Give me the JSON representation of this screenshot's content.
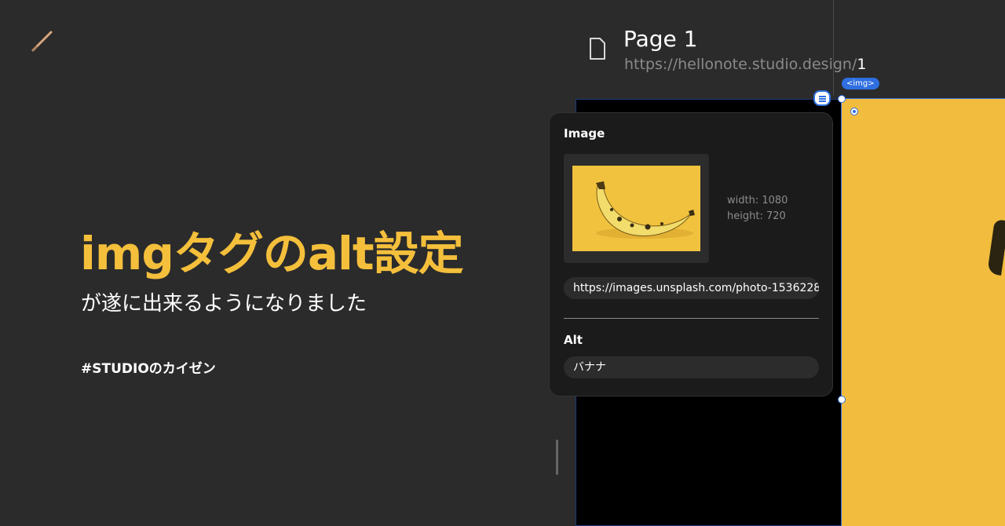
{
  "colors": {
    "accent": "#f4bf3b",
    "background": "#2b2b2b",
    "selection": "#2f6fe0"
  },
  "icons": {
    "pencil": "pencil-icon",
    "page": "page-icon",
    "menu": "menu-icon"
  },
  "hero": {
    "title": "imgタグのalt設定",
    "subtitle": "が遂に出来るようになりました",
    "hashtag": "#STUDIOのカイゼン"
  },
  "page": {
    "title": "Page 1",
    "url_base": "https://hellonote.studio.design/",
    "url_num": "1"
  },
  "canvas": {
    "tag_label": "<img>"
  },
  "image_panel": {
    "title": "Image",
    "width_label": "width: 1080",
    "height_label": "height: 720",
    "url_value": "https://images.unsplash.com/photo-15362288",
    "alt_label": "Alt",
    "alt_value": "バナナ"
  }
}
